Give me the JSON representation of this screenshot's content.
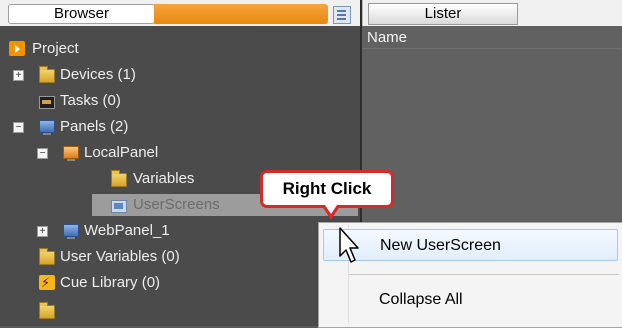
{
  "browser": {
    "tab_label": "Browser"
  },
  "tree": {
    "items": [
      {
        "label": "Project",
        "icon": "project-icon"
      },
      {
        "label": "Devices (1)",
        "icon": "devices-folder-icon",
        "expander": "+"
      },
      {
        "label": "Tasks (0)",
        "icon": "tasks-icon"
      },
      {
        "label": "Panels (2)",
        "icon": "panels-icon",
        "expander": "−"
      },
      {
        "label": "LocalPanel",
        "icon": "local-panel-icon",
        "expander": "−"
      },
      {
        "label": "Variables",
        "icon": "variables-folder-icon"
      },
      {
        "label": "UserScreens",
        "icon": "userscreens-icon",
        "selected": true
      },
      {
        "label": "WebPanel_1",
        "icon": "web-panel-icon",
        "expander": "+"
      },
      {
        "label": "User Variables (0)",
        "icon": "user-variables-folder-icon"
      },
      {
        "label": "Cue Library (0)",
        "icon": "cue-library-icon"
      }
    ]
  },
  "lister": {
    "tab_label": "Lister",
    "column_name": "Name"
  },
  "context_menu": {
    "items": [
      {
        "label": "New UserScreen",
        "highlighted": true
      },
      {
        "label": "Collapse All"
      }
    ]
  },
  "callout": {
    "text": "Right Click",
    "border_color": "#d62b2b"
  },
  "colors": {
    "accent": "#f29400",
    "panel_bg": "#4b4b4b",
    "selection_bg": "#9c9c9c"
  }
}
